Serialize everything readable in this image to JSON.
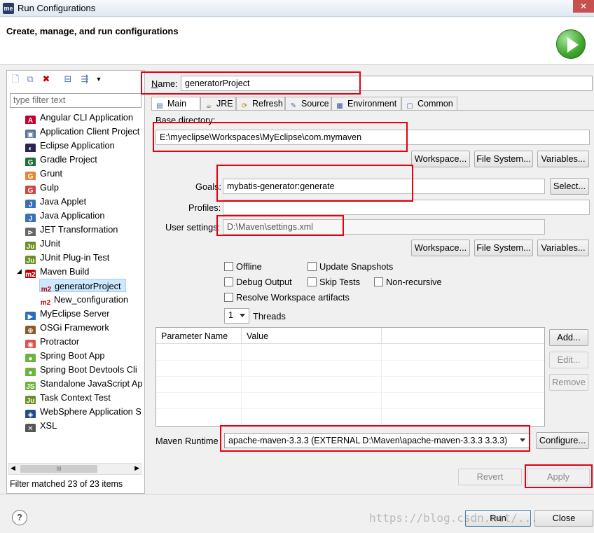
{
  "window": {
    "title": "Run Configurations",
    "app_icon": "me",
    "close_glyph": "✕"
  },
  "header": {
    "title": "Create, manage, and run configurations"
  },
  "left": {
    "toolbar": [
      "new-config-icon",
      "duplicate-icon",
      "delete-icon",
      "collapse-all-icon",
      "filter-icon",
      "dropdown-icon"
    ],
    "filter_placeholder": "type filter text",
    "items": [
      {
        "label": "Angular CLI Application",
        "icon": "A",
        "color": "#c3002f"
      },
      {
        "label": "Application Client Project",
        "icon": "▣",
        "color": "#5a6fa0"
      },
      {
        "label": "Eclipse Application",
        "icon": "◐",
        "color": "#2c2255"
      },
      {
        "label": "Gradle Project",
        "icon": "G",
        "color": "#1f6f3a"
      },
      {
        "label": "Grunt",
        "icon": "G",
        "color": "#e48632"
      },
      {
        "label": "Gulp",
        "icon": "G",
        "color": "#cf4647"
      },
      {
        "label": "Java Applet",
        "icon": "J",
        "color": "#3a70b6"
      },
      {
        "label": "Java Application",
        "icon": "J",
        "color": "#3a70b6"
      },
      {
        "label": "JET Transformation",
        "icon": "⊳",
        "color": "#666666"
      },
      {
        "label": "JUnit",
        "icon": "Ju",
        "color": "#6b8e23"
      },
      {
        "label": "JUnit Plug-in Test",
        "icon": "Ju",
        "color": "#6b8e23"
      },
      {
        "label": "Maven Build",
        "icon": "m2",
        "color": "#c00000"
      },
      {
        "label": "MyEclipse Server",
        "icon": "▶",
        "color": "#2a6dc0"
      },
      {
        "label": "OSGi Framework",
        "icon": "⊕",
        "color": "#8a5a2b"
      },
      {
        "label": "Protractor",
        "icon": "◉",
        "color": "#d9534f"
      },
      {
        "label": "Spring Boot App",
        "icon": "●",
        "color": "#6db33f"
      },
      {
        "label": "Spring Boot Devtools Cli",
        "icon": "●",
        "color": "#6db33f"
      },
      {
        "label": "Standalone JavaScript Ap",
        "icon": "JS",
        "color": "#6db33f"
      },
      {
        "label": "Task Context Test",
        "icon": "Ju",
        "color": "#6b8e23"
      },
      {
        "label": "WebSphere Application S",
        "icon": "◈",
        "color": "#1f4e8c"
      },
      {
        "label": "XSL",
        "icon": "✕",
        "color": "#555555"
      }
    ],
    "maven_children": [
      {
        "label": "generatorProject",
        "icon": "m2"
      },
      {
        "label": "New_configuration",
        "icon": "m2"
      }
    ],
    "scroll_label": "III",
    "status": "Filter matched 23 of 23 items"
  },
  "name": {
    "label_prefix": "N",
    "label_rest": "ame:",
    "value": "generatorProject"
  },
  "tabs": [
    {
      "label": "Main",
      "icon": "▤"
    },
    {
      "label": "JRE",
      "icon": "☕"
    },
    {
      "label": "Refresh",
      "icon": "⟳"
    },
    {
      "label": "Source",
      "icon": "✎"
    },
    {
      "label": "Environment",
      "icon": "▦"
    },
    {
      "label": "Common",
      "icon": "▢"
    }
  ],
  "main": {
    "base_dir_label": "Base directory:",
    "base_dir_value": "E:\\myeclipse\\Workspaces\\MyEclipse\\com.mymaven",
    "workspace_btn": "Workspace...",
    "filesystem_btn": "File System...",
    "variables_btn": "Variables...",
    "goals_label": "Goals:",
    "goals_value": "mybatis-generator:generate",
    "select_btn": "Select...",
    "profiles_label": "Profiles:",
    "profiles_value": "",
    "user_settings_label": "User settings:",
    "user_settings_value": "D:\\Maven\\settings.xml",
    "offline": "Offline",
    "update_snapshots": "Update Snapshots",
    "debug_output": "Debug Output",
    "skip_tests": "Skip Tests",
    "non_recursive": "Non-recursive",
    "resolve_workspace": "Resolve Workspace artifacts",
    "threads_value": "1",
    "threads_label": "Threads",
    "param_col": "Parameter Name",
    "value_col": "Value",
    "add_btn": "Add...",
    "edit_btn": "Edit...",
    "remove_btn": "Remove",
    "runtime_label": "Maven Runtime",
    "runtime_value": "apache-maven-3.3.3 (EXTERNAL D:\\Maven\\apache-maven-3.3.3 3.3.3)",
    "configure_btn": "Configure..."
  },
  "footer": {
    "revert_btn": "Revert",
    "apply_btn": "Apply",
    "run_btn": "Run",
    "close_btn": "Close",
    "help_glyph": "?",
    "watermark": "https://blog.csdn.net/..."
  },
  "colors": {
    "highlight": "#e60012",
    "selection": "#cde8ff"
  }
}
